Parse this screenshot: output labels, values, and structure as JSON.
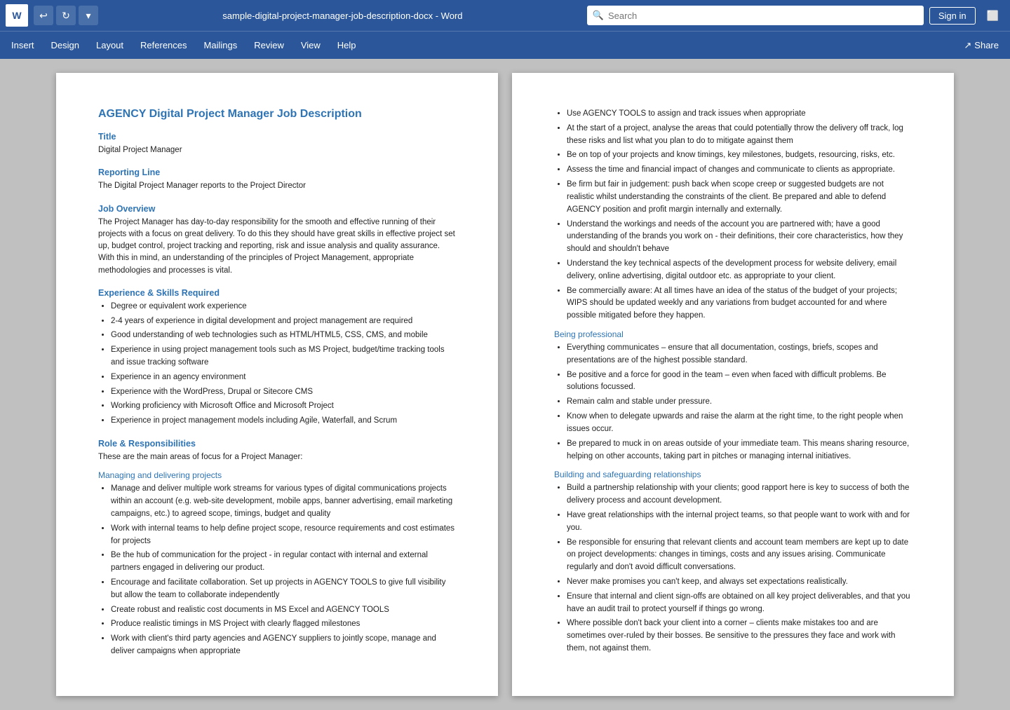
{
  "titlebar": {
    "icon_label": "W",
    "title": "sample-digital-project-manager-job-description-docx  -  Word",
    "search_placeholder": "Search",
    "signin_label": "Sign in",
    "app_name": "Word"
  },
  "menubar": {
    "items": [
      "Insert",
      "Design",
      "Layout",
      "References",
      "Mailings",
      "Review",
      "View",
      "Help"
    ],
    "share_label": "Share"
  },
  "doc_left": {
    "heading": "AGENCY Digital Project Manager Job Description",
    "title_section": "Title",
    "title_value": "Digital Project Manager",
    "reporting_line_section": "Reporting Line",
    "reporting_line_value": "The Digital Project Manager reports to the Project Director",
    "job_overview_section": "Job Overview",
    "job_overview_text": "The Project Manager has day-to-day responsibility for the smooth and effective running of their projects with a focus on great delivery. To do this they should have great skills in effective project set up, budget control, project tracking and reporting, risk and issue analysis and quality assurance. With this in mind, an understanding of the principles of Project Management, appropriate methodologies and processes is vital.",
    "exp_skills_section": "Experience & Skills Required",
    "exp_skills_items": [
      "Degree or equivalent work experience",
      "2-4 years of experience in digital development and project management are required",
      "Good understanding of web technologies such as HTML/HTML5, CSS, CMS, and mobile",
      "Experience in using project management tools such as MS Project, budget/time tracking tools and issue tracking software",
      "Experience in an agency environment",
      "Experience with the WordPress, Drupal or Sitecore CMS",
      "Working proficiency with Microsoft Office and Microsoft Project",
      "Experience in project management models including Agile, Waterfall, and Scrum"
    ],
    "role_section": "Role & Responsibilities",
    "role_intro": "These are the main areas of focus for a Project Manager:",
    "managing_section": "Managing and delivering projects",
    "managing_items": [
      "Manage and deliver multiple work streams for various types of digital communications projects within an account (e.g. web-site development, mobile apps, banner advertising, email marketing campaigns, etc.) to agreed scope, timings, budget and quality",
      "Work with internal teams to help define project scope, resource requirements and cost estimates for projects",
      "Be the hub of communication for the project - in regular contact with internal and external partners engaged in delivering our product.",
      "Encourage and facilitate collaboration. Set up projects in AGENCY TOOLS to give full visibility but allow the team to collaborate independently",
      "Create robust and realistic cost documents in MS Excel and AGENCY TOOLS",
      "Produce realistic timings in MS Project with clearly flagged milestones",
      "Work with client's third party agencies and AGENCY suppliers to jointly scope, manage and deliver campaigns when appropriate"
    ]
  },
  "doc_right": {
    "managing_continued": [
      "Use AGENCY TOOLS to assign and track issues when appropriate",
      "At the start of a project, analyse the areas that could potentially throw the delivery off track, log these risks and list what you plan to do to mitigate against them",
      "Be on top of your projects and know timings, key milestones, budgets, resourcing, risks, etc.",
      "Assess the time and financial impact of changes and communicate to clients as appropriate.",
      "Be firm but fair in judgement: push back when scope creep or suggested budgets are not realistic whilst understanding the constraints of the client. Be prepared and able to defend AGENCY position and profit margin internally and externally.",
      "Understand the workings and needs of the account you are partnered with; have a good understanding of the brands you work on - their definitions, their core characteristics, how they should and shouldn't behave",
      "Understand the key technical aspects of the development process for website delivery, email delivery, online advertising, digital outdoor etc. as appropriate to your client.",
      "Be commercially aware: At all times have an idea of the status of the budget of your projects; WIPS should be updated weekly and any variations from budget accounted for and where possible mitigated before they happen."
    ],
    "being_professional_section": "Being professional",
    "being_professional_items": [
      "Everything communicates – ensure that all documentation, costings, briefs, scopes and presentations are of the highest possible standard.",
      "Be positive and a force for good in the team – even when faced with difficult problems. Be solutions focussed.",
      "Remain calm and stable under pressure.",
      "Know when to delegate upwards and raise the alarm at the right time, to the right people when issues occur.",
      "Be prepared to muck in on areas outside of your immediate team. This means sharing resource, helping on other accounts, taking part in pitches or managing internal initiatives."
    ],
    "building_section": "Building and safeguarding relationships",
    "building_items": [
      "Build a partnership relationship with your clients; good rapport here is key to success of both the delivery process and account development.",
      "Have great relationships with the internal project teams, so that people want to work with and for you.",
      "Be responsible for ensuring that relevant clients and account team members are kept up to date on project developments: changes in timings, costs and any issues arising. Communicate regularly and don't avoid difficult conversations.",
      "Never make promises you can't keep, and always set expectations realistically.",
      "Ensure that internal and client sign-offs are obtained on all key project deliverables, and that you have an audit trail to protect yourself if things go wrong.",
      "Where possible don't back your client into a corner – clients make mistakes too and are sometimes over-ruled by their bosses. Be sensitive to the pressures they face and work with them, not against them."
    ]
  }
}
